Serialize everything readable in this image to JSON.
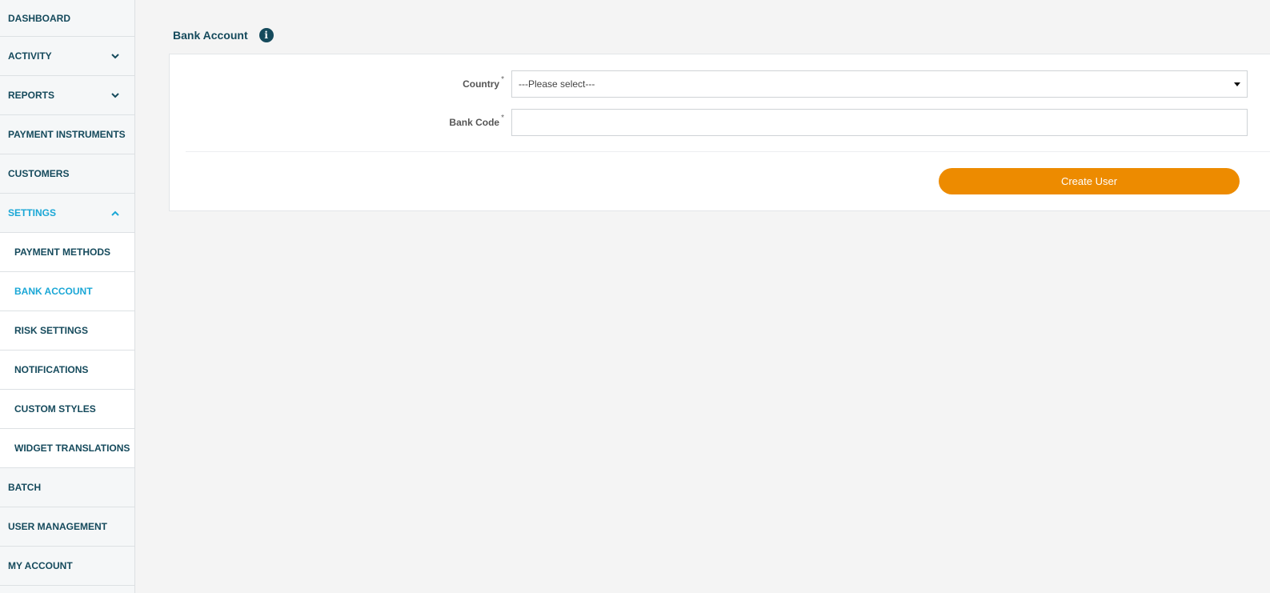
{
  "sidebar": {
    "items": [
      {
        "label": "DASHBOARD"
      },
      {
        "label": "ACTIVITY",
        "chevron": "chevron-down-icon"
      },
      {
        "label": "REPORTS",
        "chevron": "chevron-down-icon"
      },
      {
        "label": "PAYMENT INSTRUMENTS"
      },
      {
        "label": "CUSTOMERS"
      },
      {
        "label": "SETTINGS",
        "chevron": "chevron-up-icon",
        "active": true
      },
      {
        "label": "BATCH"
      },
      {
        "label": "USER MANAGEMENT"
      },
      {
        "label": "MY ACCOUNT"
      }
    ],
    "settings_subitems": [
      {
        "label": "PAYMENT METHODS"
      },
      {
        "label": "BANK ACCOUNT",
        "active": true
      },
      {
        "label": "RISK SETTINGS"
      },
      {
        "label": "NOTIFICATIONS"
      },
      {
        "label": "CUSTOM STYLES"
      },
      {
        "label": "WIDGET TRANSLATIONS"
      }
    ]
  },
  "page": {
    "title": "Bank Account",
    "info_icon": "info-icon"
  },
  "form": {
    "country": {
      "label": "Country",
      "required_mark": "*",
      "value": "---Please select---"
    },
    "bank_code": {
      "label": "Bank Code",
      "required_mark": "*",
      "value": ""
    }
  },
  "actions": {
    "create_label": "Create User"
  },
  "colors": {
    "primary_text": "#154a5c",
    "active": "#1aa7d6",
    "accent": "#ed8b00",
    "background": "#f4f4f4"
  }
}
